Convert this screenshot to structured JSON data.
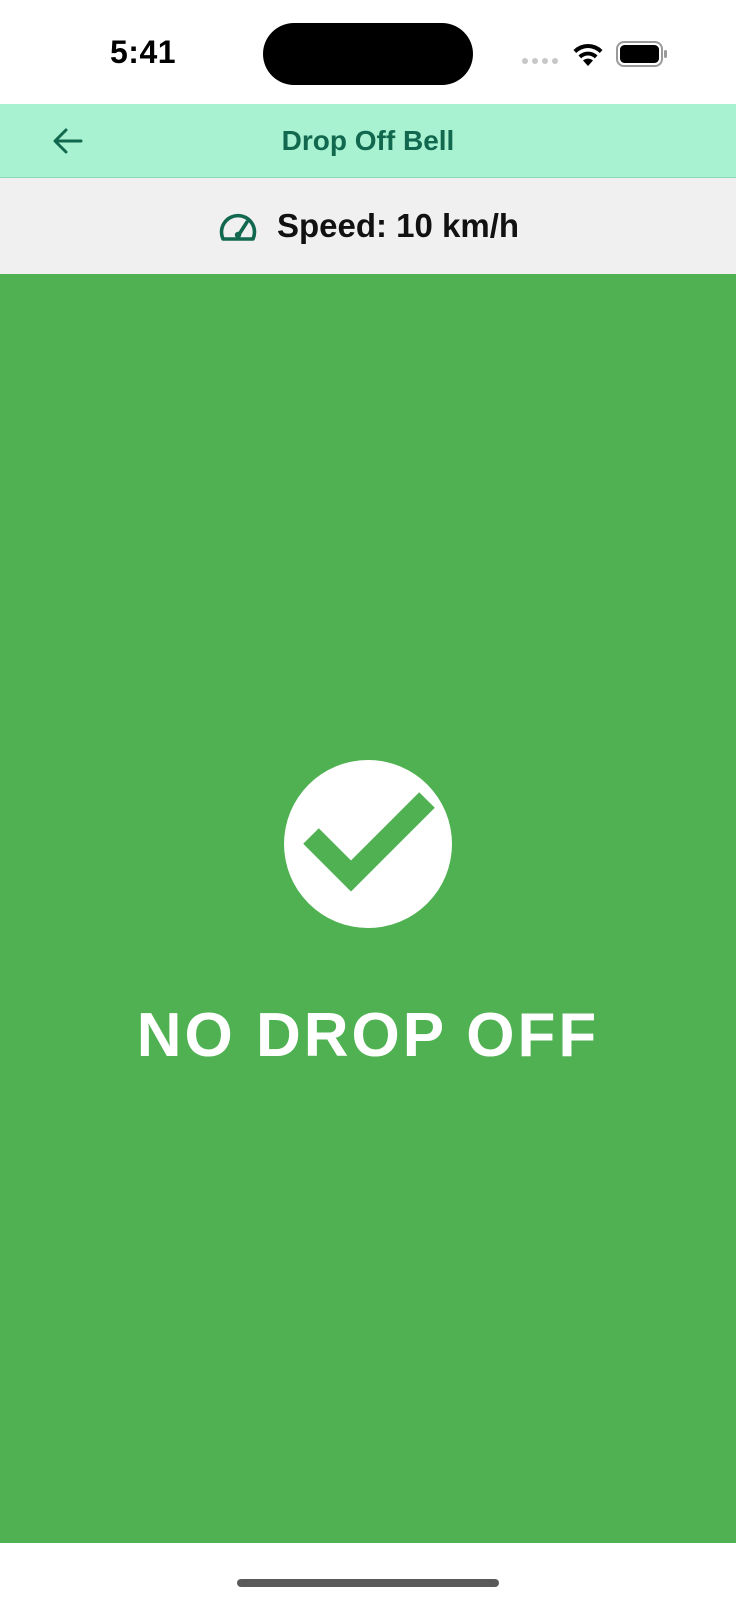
{
  "status_bar": {
    "time": "5:41",
    "icons": [
      "signal-dots-icon",
      "wifi-icon",
      "battery-icon"
    ]
  },
  "header": {
    "title": "Drop Off Bell",
    "back_icon": "arrow-left-icon",
    "background_color": "#a8f2d2",
    "title_color": "#11684f"
  },
  "speed": {
    "icon": "speedometer-icon",
    "text": "Speed: 10 km/h"
  },
  "status": {
    "icon": "check-circle-icon",
    "label": "NO DROP OFF",
    "background_color": "#4fb151"
  }
}
